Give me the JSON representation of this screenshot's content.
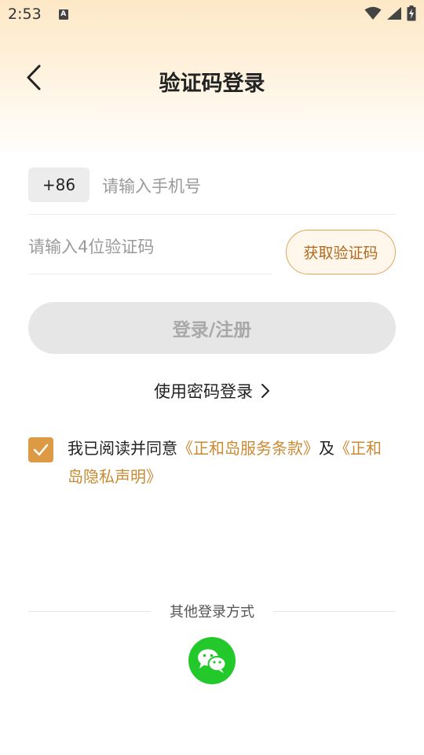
{
  "status_bar": {
    "time": "2:53",
    "notification_icon_letter": "A",
    "icons": [
      "wifi-icon",
      "signal-icon",
      "battery-charging-icon"
    ]
  },
  "header": {
    "title": "验证码登录",
    "back_icon": "chevron-left-icon"
  },
  "phone": {
    "country_code": "+86",
    "placeholder": "请输入手机号",
    "value": ""
  },
  "code": {
    "placeholder": "请输入4位验证码",
    "value": "",
    "get_code_label": "获取验证码"
  },
  "login_button_label": "登录/注册",
  "password_login_label": "使用密码登录",
  "agreement": {
    "checked": true,
    "prefix": "我已阅读并同意",
    "terms_link": "《正和岛服务条款》",
    "conjunction": "及",
    "privacy_link": "《正和岛隐私声明》"
  },
  "other_login": {
    "label": "其他登录方式",
    "wechat_icon": "wechat-icon"
  },
  "colors": {
    "accent": "#dc9a45",
    "link": "#c98a32",
    "wechat": "#23c92a",
    "disabled_button": "#e6e6e6"
  }
}
